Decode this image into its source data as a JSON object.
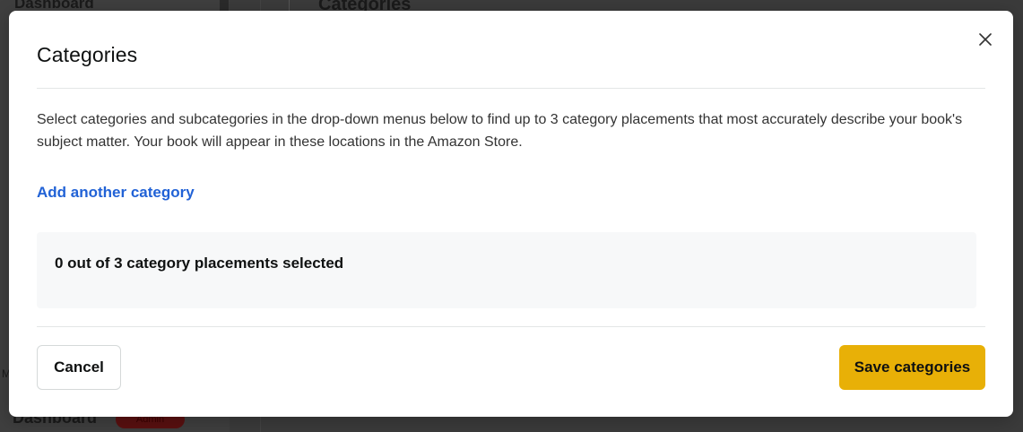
{
  "background": {
    "sidebar_top_text": "Dashboard",
    "main_heading_partial": "Categories",
    "sidebar_bottom_text": "Dashboard",
    "badge_text": "Admin",
    "edge_letter": "M"
  },
  "modal": {
    "title": "Categories",
    "close_icon": "close-icon",
    "description": "Select categories and subcategories in the drop-down menus below to find up to 3 category placements that most accurately describe your book's subject matter. Your book will appear in these locations in the Amazon Store.",
    "add_link_label": "Add another category",
    "placement_status": "0 out of 3 category placements selected",
    "cancel_label": "Cancel",
    "save_label": "Save categories"
  },
  "colors": {
    "link": "#2162d6",
    "primary_button": "#e8b007",
    "overlay": "#3a3a3a"
  }
}
